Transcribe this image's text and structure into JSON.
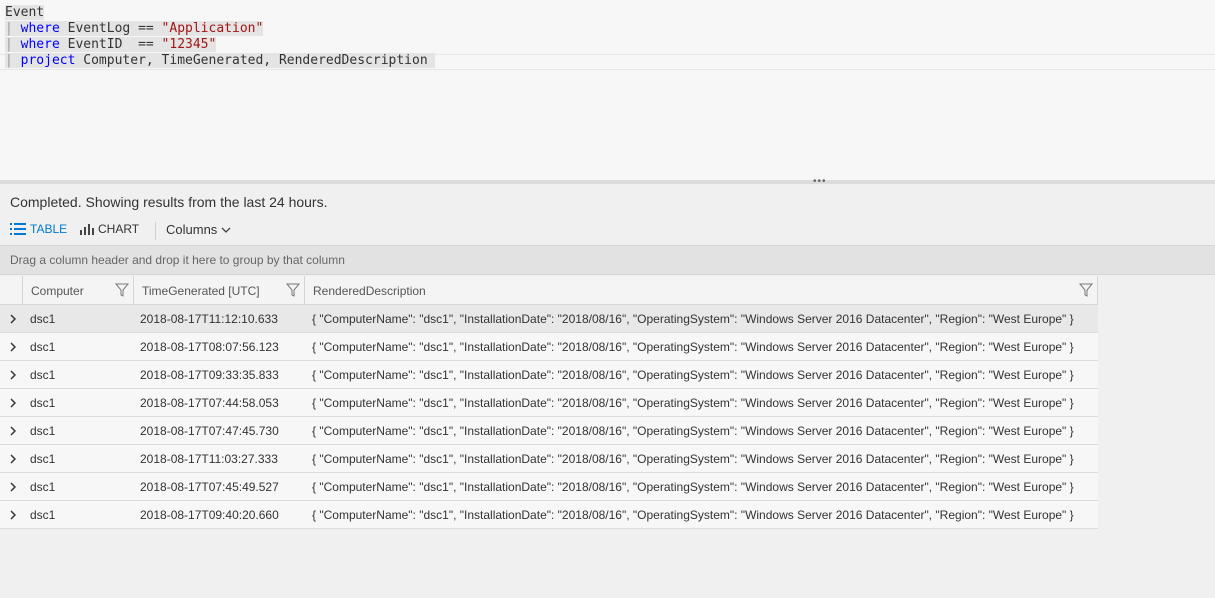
{
  "query": {
    "line1": {
      "text": "Event"
    },
    "line2": {
      "bar": "| ",
      "kw": "where",
      "mid": " EventLog == ",
      "str": "\"Application\""
    },
    "line3": {
      "bar": "| ",
      "kw": "where",
      "mid": " EventID  == ",
      "str": "\"12345\""
    },
    "line4": {
      "bar": "| ",
      "kw": "project",
      "mid": " Computer, TimeGenerated, RenderedDescription "
    }
  },
  "status": "Completed. Showing results from the last 24 hours.",
  "toolbar": {
    "table_label": "TABLE",
    "chart_label": "CHART",
    "columns_label": "Columns"
  },
  "group_hint": "Drag a column header and drop it here to group by that column",
  "columns": [
    "Computer",
    "TimeGenerated [UTC]",
    "RenderedDescription"
  ],
  "rows": [
    {
      "computer": "dsc1",
      "time": "2018-08-17T11:12:10.633",
      "desc": "{ \"ComputerName\": \"dsc1\", \"InstallationDate\": \"2018/08/16\", \"OperatingSystem\": \"Windows Server 2016 Datacenter\", \"Region\": \"West Europe\" }"
    },
    {
      "computer": "dsc1",
      "time": "2018-08-17T08:07:56.123",
      "desc": "{ \"ComputerName\": \"dsc1\", \"InstallationDate\": \"2018/08/16\", \"OperatingSystem\": \"Windows Server 2016 Datacenter\", \"Region\": \"West Europe\" }"
    },
    {
      "computer": "dsc1",
      "time": "2018-08-17T09:33:35.833",
      "desc": "{ \"ComputerName\": \"dsc1\", \"InstallationDate\": \"2018/08/16\", \"OperatingSystem\": \"Windows Server 2016 Datacenter\", \"Region\": \"West Europe\" }"
    },
    {
      "computer": "dsc1",
      "time": "2018-08-17T07:44:58.053",
      "desc": "{ \"ComputerName\": \"dsc1\", \"InstallationDate\": \"2018/08/16\", \"OperatingSystem\": \"Windows Server 2016 Datacenter\", \"Region\": \"West Europe\" }"
    },
    {
      "computer": "dsc1",
      "time": "2018-08-17T07:47:45.730",
      "desc": "{ \"ComputerName\": \"dsc1\", \"InstallationDate\": \"2018/08/16\", \"OperatingSystem\": \"Windows Server 2016 Datacenter\", \"Region\": \"West Europe\" }"
    },
    {
      "computer": "dsc1",
      "time": "2018-08-17T11:03:27.333",
      "desc": "{ \"ComputerName\": \"dsc1\", \"InstallationDate\": \"2018/08/16\", \"OperatingSystem\": \"Windows Server 2016 Datacenter\", \"Region\": \"West Europe\" }"
    },
    {
      "computer": "dsc1",
      "time": "2018-08-17T07:45:49.527",
      "desc": "{ \"ComputerName\": \"dsc1\", \"InstallationDate\": \"2018/08/16\", \"OperatingSystem\": \"Windows Server 2016 Datacenter\", \"Region\": \"West Europe\" }"
    },
    {
      "computer": "dsc1",
      "time": "2018-08-17T09:40:20.660",
      "desc": "{ \"ComputerName\": \"dsc1\", \"InstallationDate\": \"2018/08/16\", \"OperatingSystem\": \"Windows Server 2016 Datacenter\", \"Region\": \"West Europe\" }"
    }
  ],
  "colors": {
    "accent": "#0078d4",
    "keyword": "#0000ff",
    "string": "#a31515"
  }
}
